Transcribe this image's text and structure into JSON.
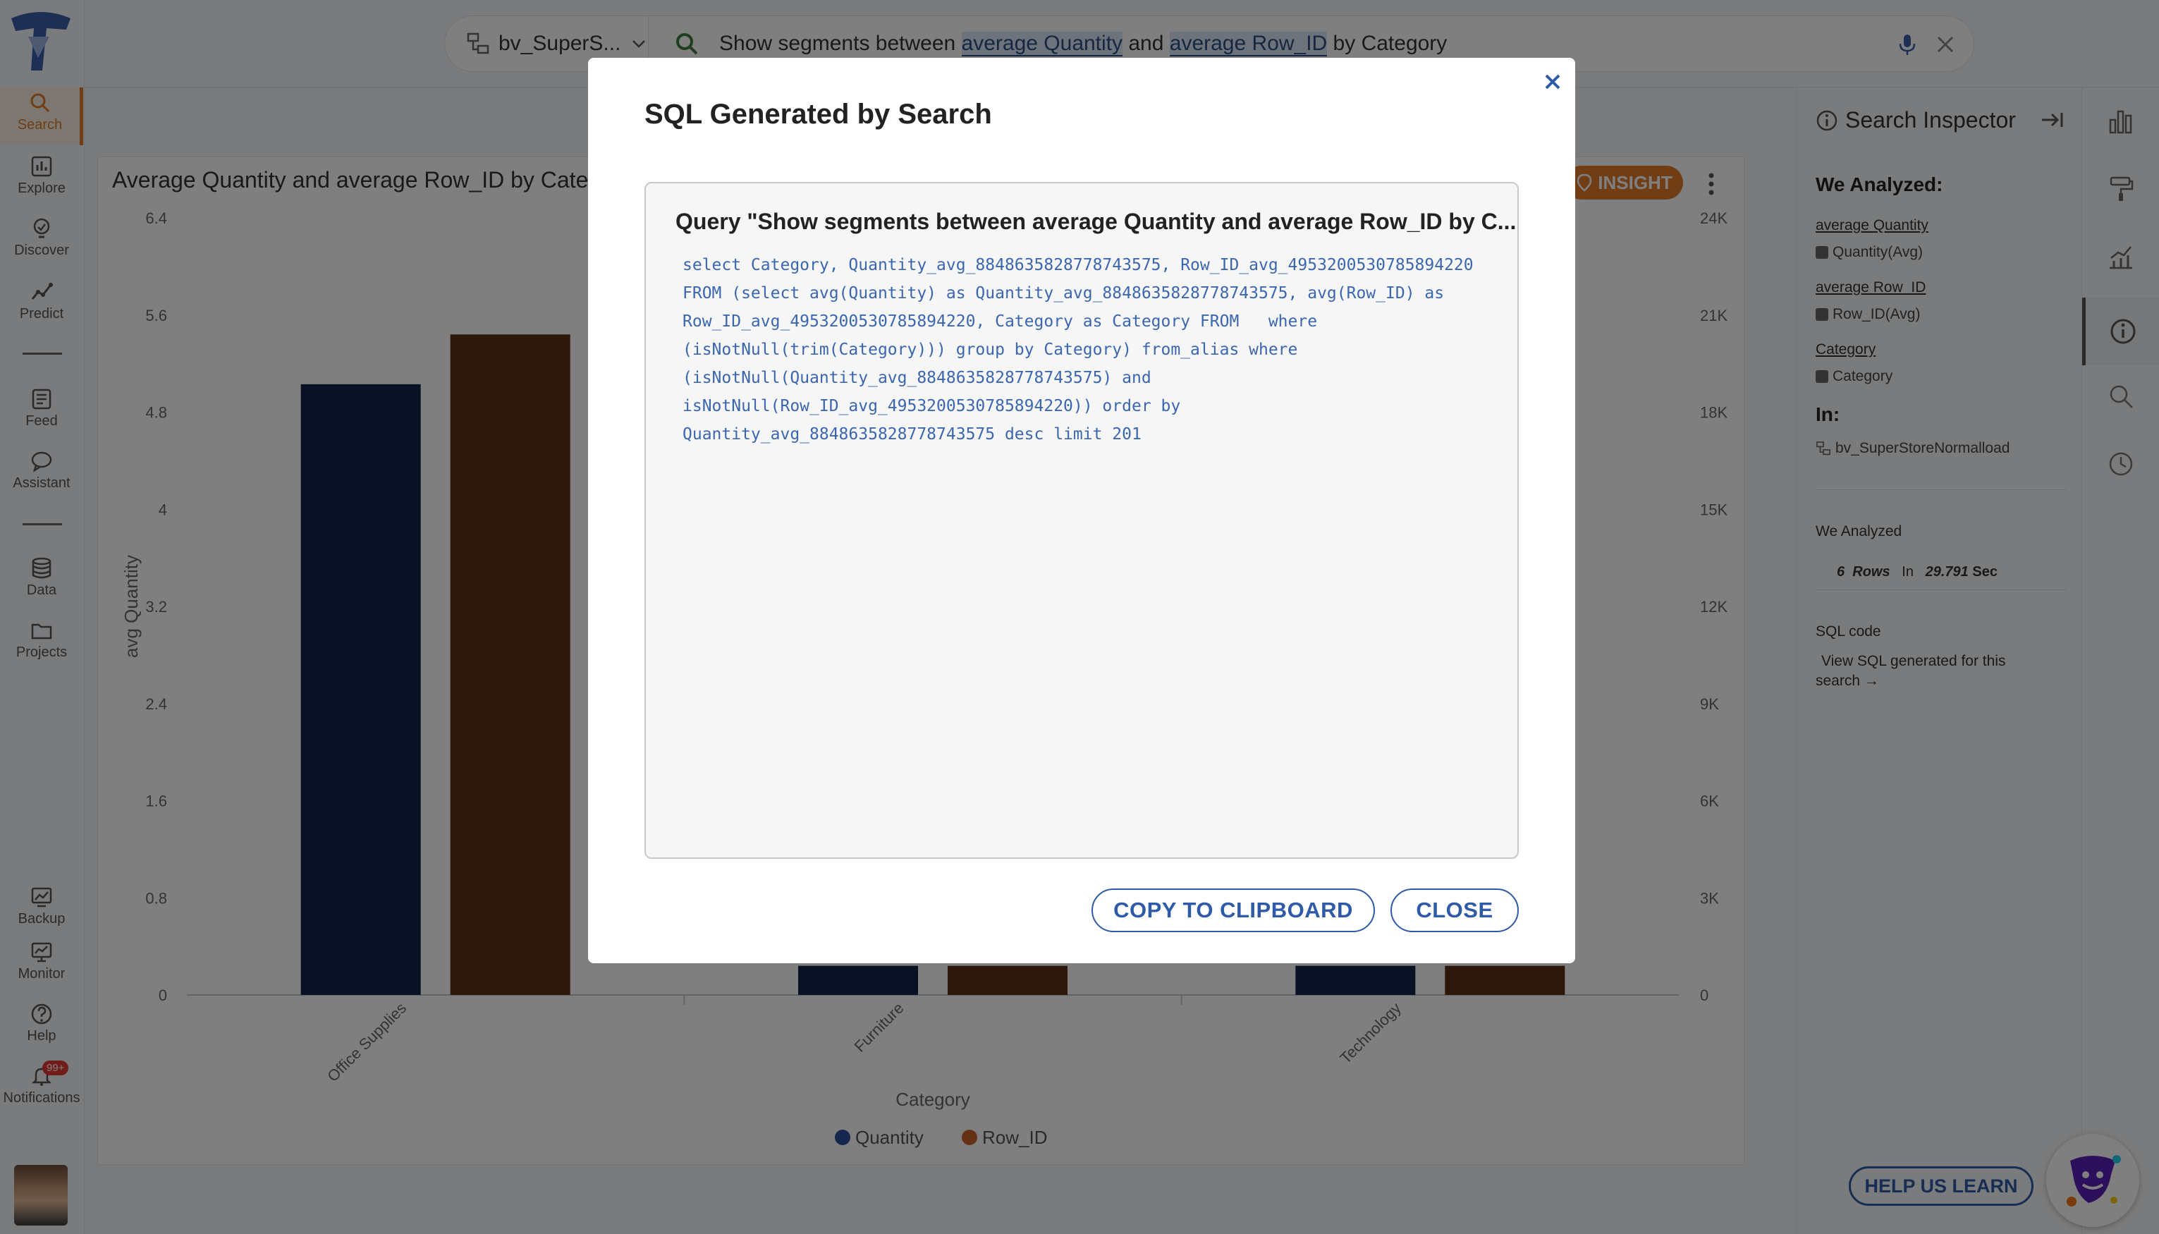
{
  "app": {
    "nav": [
      {
        "label": "Search",
        "icon": "search-icon"
      },
      {
        "label": "Explore",
        "icon": "bar-chart-icon"
      },
      {
        "label": "Discover",
        "icon": "lightbulb-icon"
      },
      {
        "label": "Predict",
        "icon": "trend-icon"
      },
      {
        "label": "Feed",
        "icon": "feed-icon"
      },
      {
        "label": "Assistant",
        "icon": "chat-icon"
      },
      {
        "label": "Data",
        "icon": "database-icon"
      },
      {
        "label": "Projects",
        "icon": "folder-icon"
      },
      {
        "label": "Backup",
        "icon": "backup-icon"
      },
      {
        "label": "Monitor",
        "icon": "monitor-icon"
      },
      {
        "label": "Help",
        "icon": "help-icon"
      },
      {
        "label": "Notifications",
        "icon": "bell-icon"
      }
    ],
    "notification_badge": "99+"
  },
  "topbar": {
    "datasource": "bv_SuperS...",
    "query_parts": [
      "Show segments between ",
      "average Quantity",
      " and ",
      "average Row_ID",
      " by Category"
    ]
  },
  "chart_card": {
    "title": "Average Quantity and average Row_ID by Categ",
    "insight_label": "INSIGHT"
  },
  "chart_data": {
    "type": "bar",
    "categories": [
      "Office Supplies",
      "Furniture",
      "Technology"
    ],
    "series": [
      {
        "name": "Quantity",
        "axis": "left",
        "values": [
          5.03,
          0.24,
          0.24
        ],
        "color": "#13254a"
      },
      {
        "name": "Row_ID",
        "axis": "right",
        "values": [
          20400,
          900,
          900
        ],
        "color": "#5a2d14"
      }
    ],
    "xlabel": "Category",
    "ylabel": "avg Quantity",
    "ylim": [
      0,
      6.4
    ],
    "y2lim": [
      0,
      24000
    ],
    "yticks": [
      "0",
      "0.8",
      "1.6",
      "2.4",
      "3.2",
      "4",
      "4.8",
      "5.6",
      "6.4"
    ],
    "y2ticks": [
      "0",
      "3K",
      "6K",
      "9K",
      "12K",
      "15K",
      "18K",
      "21K",
      "24K"
    ],
    "legend": "bottom"
  },
  "inspector": {
    "title": "Search Inspector",
    "we_analyzed_heading": "We Analyzed:",
    "items": [
      {
        "link": "average Quantity",
        "sub": "Quantity(Avg)"
      },
      {
        "link": "average Row_ID",
        "sub": "Row_ID(Avg)"
      },
      {
        "link": "Category",
        "sub": "Category"
      }
    ],
    "in_heading": "In:",
    "dataset": "bv_SuperStoreNormalload",
    "we_analyzed_label": "We Analyzed",
    "rows_value": "6",
    "rows_label": "Rows",
    "in_label": "In",
    "time_value": "29.791",
    "time_unit": "Sec",
    "sql_code_label": "SQL code",
    "view_sql_text": "View SQL generated for this search →",
    "help_learn": "HELP US LEARN"
  },
  "modal": {
    "title": "SQL Generated by Search",
    "query_title": "Query \"Show segments between average Quantity and average Row_ID by C...",
    "sql_lines": [
      "select Category, Quantity_avg_8848635828778743575, Row_ID_avg_4953200530785894220",
      "FROM (select avg(Quantity) as Quantity_avg_8848635828778743575, avg(Row_ID) as",
      "Row_ID_avg_4953200530785894220, Category as Category FROM   where",
      "(isNotNull(trim(Category))) group by Category) from_alias where",
      "(isNotNull(Quantity_avg_8848635828778743575) and",
      "isNotNull(Row_ID_avg_4953200530785894220)) order by",
      "Quantity_avg_8848635828778743575 desc limit 201"
    ],
    "copy_label": "COPY TO CLIPBOARD",
    "close_label": "CLOSE"
  }
}
